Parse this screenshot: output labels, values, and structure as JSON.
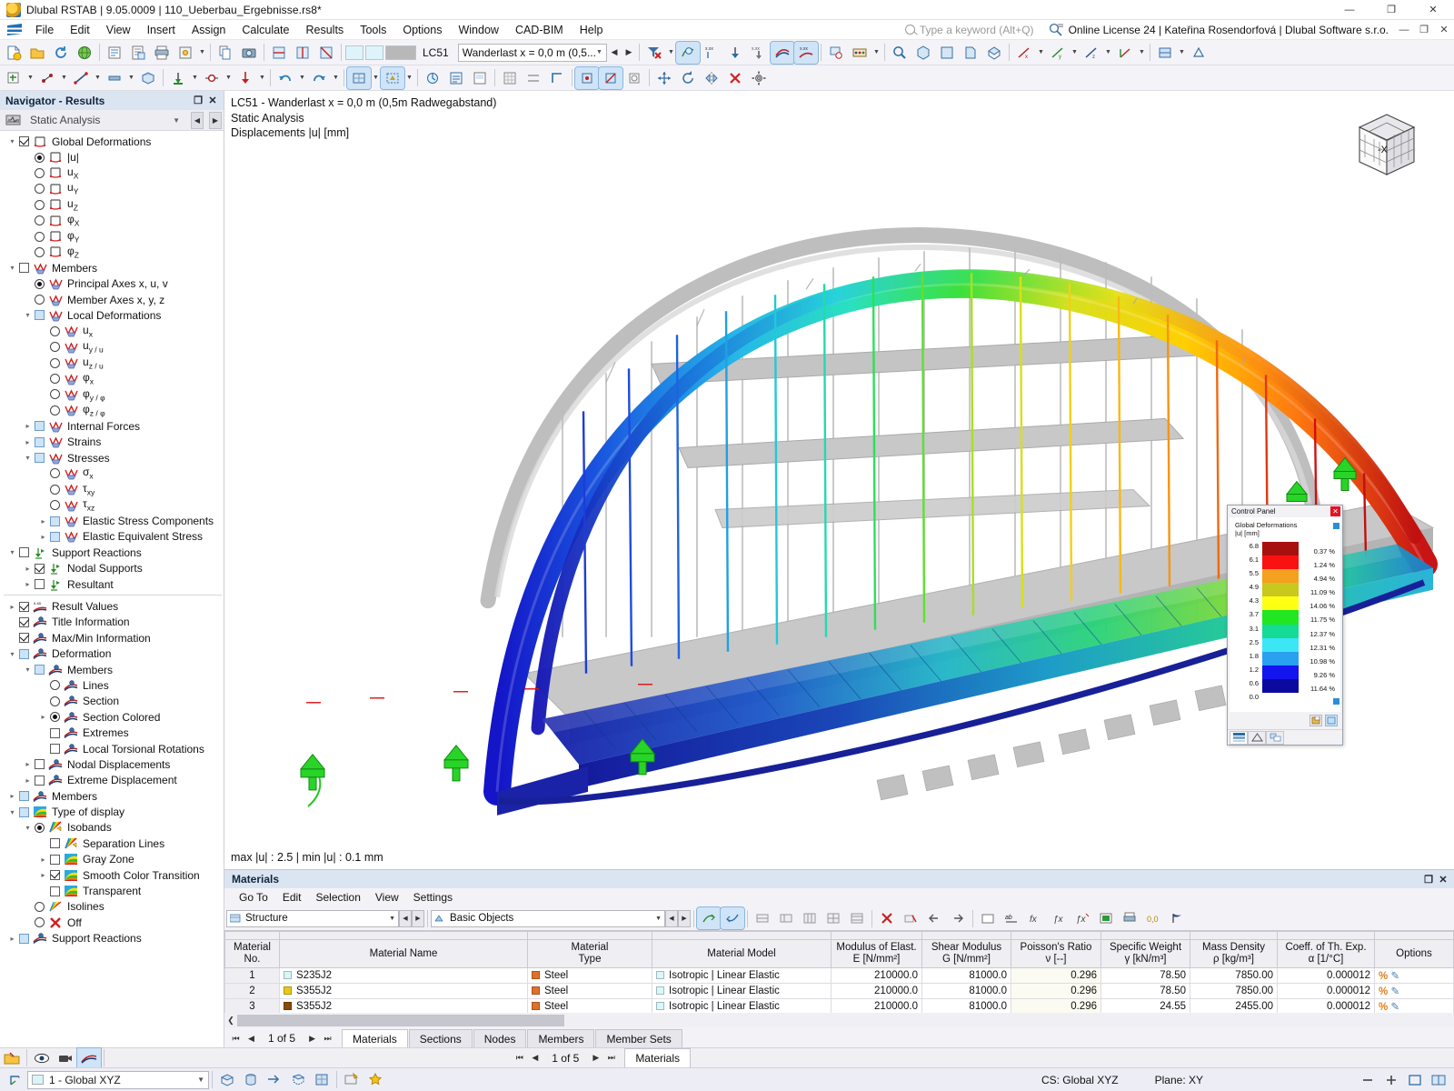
{
  "window": {
    "title": "Dlubal RSTAB | 9.05.0009 | 110_Ueberbau_Ergebnisse.rs8*",
    "minimize": "—",
    "maximize": "❐",
    "close": "✕"
  },
  "menubar": {
    "items": [
      "File",
      "Edit",
      "View",
      "Insert",
      "Assign",
      "Calculate",
      "Results",
      "Tools",
      "Options",
      "Window",
      "CAD-BIM",
      "Help"
    ],
    "search_placeholder": "Type a keyword (Alt+Q)",
    "license": "Online License 24 | Kateřina Rosendorfová | Dlubal Software s.r.o."
  },
  "toolbar": {
    "load_case": "LC51",
    "load_case_description": "Wanderlast x = 0,0 m (0,5...",
    "prev_label": "◀",
    "next_label": "▶"
  },
  "navigator": {
    "title": "Navigator - Results",
    "restore_icon": "❐",
    "close_icon": "✕",
    "analysis_type": "Static Analysis",
    "tree": [
      {
        "label": "Global Deformations",
        "indent": 0,
        "twisty": "down",
        "ctl": "checkbox-checked",
        "icon": "global-deformation"
      },
      {
        "label": "|u|",
        "indent": 1,
        "twisty": "none",
        "ctl": "radio-on",
        "icon": "global-deformation"
      },
      {
        "label": "u",
        "sub": "X",
        "indent": 1,
        "twisty": "none",
        "ctl": "radio-off",
        "icon": "global-deformation"
      },
      {
        "label": "u",
        "sub": "Y",
        "indent": 1,
        "twisty": "none",
        "ctl": "radio-off",
        "icon": "global-deformation"
      },
      {
        "label": "u",
        "sub": "Z",
        "indent": 1,
        "twisty": "none",
        "ctl": "radio-off",
        "icon": "global-deformation"
      },
      {
        "label": "φ",
        "sub": "X",
        "indent": 1,
        "twisty": "none",
        "ctl": "radio-off",
        "icon": "global-deformation"
      },
      {
        "label": "φ",
        "sub": "Y",
        "indent": 1,
        "twisty": "none",
        "ctl": "radio-off",
        "icon": "global-deformation"
      },
      {
        "label": "φ",
        "sub": "Z",
        "indent": 1,
        "twisty": "none",
        "ctl": "radio-off",
        "icon": "global-deformation"
      },
      {
        "label": "Members",
        "indent": 0,
        "twisty": "down",
        "ctl": "checkbox-empty",
        "icon": "member"
      },
      {
        "label": "Principal Axes x, u, v",
        "indent": 1,
        "twisty": "none",
        "ctl": "radio-on",
        "icon": "member"
      },
      {
        "label": "Member Axes x, y, z",
        "indent": 1,
        "twisty": "none",
        "ctl": "radio-off",
        "icon": "member"
      },
      {
        "label": "Local Deformations",
        "indent": 1,
        "twisty": "down",
        "ctl": "checkbox-blue",
        "icon": "member"
      },
      {
        "label": "u",
        "sub": "x",
        "indent": 2,
        "twisty": "none",
        "ctl": "radio-off",
        "icon": "member"
      },
      {
        "label": "u",
        "sub": "y / u",
        "sub2": "u",
        "indent": 2,
        "twisty": "none",
        "ctl": "radio-off",
        "icon": "member"
      },
      {
        "label": "u",
        "sub": "z / u",
        "sub2": "v",
        "indent": 2,
        "twisty": "none",
        "ctl": "radio-off",
        "icon": "member"
      },
      {
        "label": "φ",
        "sub": "x",
        "indent": 2,
        "twisty": "none",
        "ctl": "radio-off",
        "icon": "member"
      },
      {
        "label": "φ",
        "sub": "y / φ",
        "sub2": "u",
        "indent": 2,
        "twisty": "none",
        "ctl": "radio-off",
        "icon": "member"
      },
      {
        "label": "φ",
        "sub": "z / φ",
        "sub2": "v",
        "indent": 2,
        "twisty": "none",
        "ctl": "radio-off",
        "icon": "member"
      },
      {
        "label": "Internal Forces",
        "indent": 1,
        "twisty": "right",
        "ctl": "checkbox-blue",
        "icon": "member"
      },
      {
        "label": "Strains",
        "indent": 1,
        "twisty": "right",
        "ctl": "checkbox-blue",
        "icon": "member"
      },
      {
        "label": "Stresses",
        "indent": 1,
        "twisty": "down",
        "ctl": "checkbox-blue",
        "icon": "member"
      },
      {
        "label": "σ",
        "sub": "x",
        "indent": 2,
        "twisty": "none",
        "ctl": "radio-off",
        "icon": "member"
      },
      {
        "label": "τ",
        "sub": "xy",
        "indent": 2,
        "twisty": "none",
        "ctl": "radio-off",
        "icon": "member"
      },
      {
        "label": "τ",
        "sub": "xz",
        "indent": 2,
        "twisty": "none",
        "ctl": "radio-off",
        "icon": "member"
      },
      {
        "label": "Elastic Stress Components",
        "indent": 2,
        "twisty": "right",
        "ctl": "checkbox-blue",
        "icon": "member"
      },
      {
        "label": "Elastic Equivalent Stress",
        "indent": 2,
        "twisty": "right",
        "ctl": "checkbox-blue",
        "icon": "member"
      },
      {
        "label": "Support Reactions",
        "indent": 0,
        "twisty": "down",
        "ctl": "checkbox-empty",
        "icon": "support"
      },
      {
        "label": "Nodal Supports",
        "indent": 1,
        "twisty": "right",
        "ctl": "checkbox-checked",
        "icon": "support"
      },
      {
        "label": "Resultant",
        "indent": 1,
        "twisty": "right",
        "ctl": "checkbox-empty",
        "icon": "support"
      },
      {
        "divider": true
      },
      {
        "label": "Result Values",
        "indent": 0,
        "twisty": "right",
        "ctl": "checkbox-checked",
        "icon": "result-values"
      },
      {
        "label": "Title Information",
        "indent": 0,
        "twisty": "none",
        "ctl": "checkbox-checked",
        "icon": "deformation"
      },
      {
        "label": "Max/Min Information",
        "indent": 0,
        "twisty": "none",
        "ctl": "checkbox-checked",
        "icon": "deformation"
      },
      {
        "label": "Deformation",
        "indent": 0,
        "twisty": "down",
        "ctl": "checkbox-blue",
        "icon": "deformation"
      },
      {
        "label": "Members",
        "indent": 1,
        "twisty": "down",
        "ctl": "checkbox-blue",
        "icon": "deformation"
      },
      {
        "label": "Lines",
        "indent": 2,
        "twisty": "none",
        "ctl": "radio-off",
        "icon": "deformation"
      },
      {
        "label": "Section",
        "indent": 2,
        "twisty": "none",
        "ctl": "radio-off",
        "icon": "deformation"
      },
      {
        "label": "Section Colored",
        "indent": 2,
        "twisty": "right",
        "ctl": "radio-on",
        "icon": "deformation"
      },
      {
        "label": "Extremes",
        "indent": 2,
        "twisty": "none",
        "ctl": "checkbox-empty",
        "icon": "deformation"
      },
      {
        "label": "Local Torsional Rotations",
        "indent": 2,
        "twisty": "none",
        "ctl": "checkbox-empty",
        "icon": "deformation"
      },
      {
        "label": "Nodal Displacements",
        "indent": 1,
        "twisty": "right",
        "ctl": "checkbox-empty",
        "icon": "deformation"
      },
      {
        "label": "Extreme Displacement",
        "indent": 1,
        "twisty": "right",
        "ctl": "checkbox-empty",
        "icon": "deformation"
      },
      {
        "label": "Members",
        "indent": 0,
        "twisty": "right",
        "ctl": "checkbox-blue",
        "icon": "deformation"
      },
      {
        "label": "Type of display",
        "indent": 0,
        "twisty": "down",
        "ctl": "checkbox-blue",
        "icon": "rainbow"
      },
      {
        "label": "Isobands",
        "indent": 1,
        "twisty": "down",
        "ctl": "radio-on",
        "icon": "isobands"
      },
      {
        "label": "Separation Lines",
        "indent": 2,
        "twisty": "none",
        "ctl": "checkbox-empty",
        "icon": "isobands"
      },
      {
        "label": "Gray Zone",
        "indent": 2,
        "twisty": "right",
        "ctl": "checkbox-empty",
        "icon": "rainbow"
      },
      {
        "label": "Smooth Color Transition",
        "indent": 2,
        "twisty": "right",
        "ctl": "checkbox-checked",
        "icon": "rainbow"
      },
      {
        "label": "Transparent",
        "indent": 2,
        "twisty": "none",
        "ctl": "checkbox-empty",
        "icon": "rainbow"
      },
      {
        "label": "Isolines",
        "indent": 1,
        "twisty": "none",
        "ctl": "radio-off",
        "icon": "isolines"
      },
      {
        "label": "Off",
        "indent": 1,
        "twisty": "none",
        "ctl": "radio-off",
        "icon": "off-x"
      },
      {
        "label": "Support Reactions",
        "indent": 0,
        "twisty": "right",
        "ctl": "checkbox-blue",
        "icon": "deformation"
      }
    ]
  },
  "viewport": {
    "line1": "LC51 - Wanderlast x = 0,0 m (0,5m Radwegabstand)",
    "line2": "Static Analysis",
    "line3": "Displacements |u| [mm]",
    "maxmin": "max |u| : 2.5 | min |u| : 0.1 mm",
    "nav_cube_label": "-X"
  },
  "control_panel": {
    "title": "Control Panel",
    "subtitle_line1": "Global Deformations",
    "subtitle_line2": "|u| [mm]",
    "scale_values": [
      "6.8",
      "6.1",
      "5.5",
      "4.9",
      "4.3",
      "3.7",
      "3.1",
      "2.5",
      "1.8",
      "1.2",
      "0.6",
      "0.0"
    ],
    "bands": [
      {
        "color": "#a81010",
        "pct": "0.37 %"
      },
      {
        "color": "#fa1212",
        "pct": "1.24 %"
      },
      {
        "color": "#f5a01e",
        "pct": "4.94 %"
      },
      {
        "color": "#c8c81e",
        "pct": "11.09 %"
      },
      {
        "color": "#ffff14",
        "pct": "14.06 %"
      },
      {
        "color": "#22e622",
        "pct": "11.75 %"
      },
      {
        "color": "#14dc96",
        "pct": "12.37 %"
      },
      {
        "color": "#3ce6f5",
        "pct": "12.31 %"
      },
      {
        "color": "#2aa0f0",
        "pct": "10.98 %"
      },
      {
        "color": "#1414f0",
        "pct": "9.26 %"
      },
      {
        "color": "#0a0aa0",
        "pct": "11.64 %"
      }
    ],
    "close_icon": "✕"
  },
  "table_panel": {
    "title": "Materials",
    "restore_icon": "❐",
    "close_icon": "✕",
    "menu": [
      "Go To",
      "Edit",
      "Selection",
      "View",
      "Settings"
    ],
    "structure_combo": "Structure",
    "objects_combo": "Basic Objects",
    "columns": [
      {
        "l1": "Material",
        "l2": "No."
      },
      {
        "l1": "Material Name",
        "l2": ""
      },
      {
        "l1": "Material",
        "l2": "Type"
      },
      {
        "l1": "Material Model",
        "l2": ""
      },
      {
        "l1": "Modulus of Elast.",
        "l2": "E [N/mm²]"
      },
      {
        "l1": "Shear Modulus",
        "l2": "G [N/mm²]"
      },
      {
        "l1": "Poisson's Ratio",
        "l2": "ν [--]"
      },
      {
        "l1": "Specific Weight",
        "l2": "γ [kN/m³]"
      },
      {
        "l1": "Mass Density",
        "l2": "ρ [kg/m³]"
      },
      {
        "l1": "Coeff. of Th. Exp.",
        "l2": "α [1/°C]"
      },
      {
        "l1": "Options",
        "l2": ""
      }
    ],
    "rows": [
      {
        "no": "1",
        "name": "S235J2",
        "name_color": "#d8f5fa",
        "type": "Steel",
        "type_color": "#e0702a",
        "model": "Isotropic | Linear Elastic",
        "model_color": "#d8f8fb",
        "E": "210000.0",
        "G": "81000.0",
        "nu": "0.296",
        "gamma": "78.50",
        "rho": "7850.00",
        "alpha": "0.000012",
        "selected": true
      },
      {
        "no": "2",
        "name": "S355J2",
        "name_color": "#e8c81a",
        "type": "Steel",
        "type_color": "#e0702a",
        "model": "Isotropic | Linear Elastic",
        "model_color": "#d8f8fb",
        "E": "210000.0",
        "G": "81000.0",
        "nu": "0.296",
        "gamma": "78.50",
        "rho": "7850.00",
        "alpha": "0.000012",
        "selected": false
      },
      {
        "no": "3",
        "name": "S355J2",
        "name_color": "#8a4a08",
        "type": "Steel",
        "type_color": "#e0702a",
        "model": "Isotropic | Linear Elastic",
        "model_color": "#d8f8fb",
        "E": "210000.0",
        "G": "81000.0",
        "nu": "0.296",
        "gamma": "24.55",
        "rho": "2455.00",
        "alpha": "0.000012",
        "selected": false
      }
    ],
    "page_label": "1 of 5",
    "first_icon": "⏮",
    "prev_icon": "◀",
    "next_icon": "▶",
    "last_icon": "⏭",
    "tabs": [
      "Materials",
      "Sections",
      "Nodes",
      "Members",
      "Member Sets"
    ],
    "active_tab": "Materials"
  },
  "status": {
    "page_label": "1 of 5",
    "active_tab": "Materials",
    "cs_combo": "1 - Global XYZ",
    "cs_global": "CS: Global XYZ",
    "plane": "Plane: XY"
  }
}
